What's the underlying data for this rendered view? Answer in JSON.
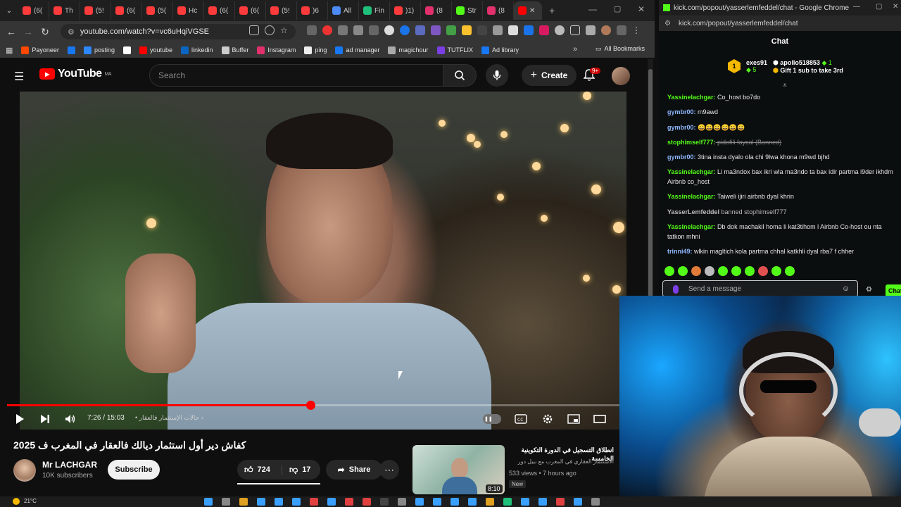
{
  "browser_left": {
    "tabs": [
      {
        "label": "(6(",
        "color": "#ff3b3b"
      },
      {
        "label": "Th",
        "color": "#ff3b3b"
      },
      {
        "label": "(5!",
        "color": "#ff3b3b"
      },
      {
        "label": "(6(",
        "color": "#ff3b3b"
      },
      {
        "label": "(5(",
        "color": "#ff3b3b"
      },
      {
        "label": "Hc",
        "color": "#ff3b3b"
      },
      {
        "label": "(6(",
        "color": "#ff3b3b"
      },
      {
        "label": "(6(",
        "color": "#ff3b3b"
      },
      {
        "label": "(5!",
        "color": "#ff3b3b"
      },
      {
        "label": ")6",
        "color": "#ff3b3b"
      },
      {
        "label": "All",
        "color": "#4c8bf5"
      },
      {
        "label": "Fin",
        "color": "#1ec07a"
      },
      {
        "label": ")1)",
        "color": "#ff3b3b"
      },
      {
        "label": "(8",
        "color": "#e1306c"
      },
      {
        "label": "Str",
        "color": "#53fc18"
      },
      {
        "label": "(8",
        "color": "#e1306c"
      }
    ],
    "new_tab": "+",
    "url": "youtube.com/watch?v=vc6uHqiVGSE",
    "bookmarks": [
      {
        "label": "Payoneer",
        "color": "#ff4800"
      },
      {
        "label": "",
        "color": "#1877f2"
      },
      {
        "label": "posting",
        "color": "#2d88ff"
      },
      {
        "label": "",
        "color": "#ffffff"
      },
      {
        "label": "youtube",
        "color": "#ff0000"
      },
      {
        "label": "linkedin",
        "color": "#0a66c2"
      },
      {
        "label": "Buffer",
        "color": "#cccccc"
      },
      {
        "label": "Instagram",
        "color": "#e1306c"
      },
      {
        "label": "ping",
        "color": "#eeeeee"
      },
      {
        "label": "ad manager",
        "color": "#1877f2"
      },
      {
        "label": "magichour",
        "color": "#aaaaaa"
      },
      {
        "label": "TUTFLIX",
        "color": "#7b3fe4"
      },
      {
        "label": "Ad library",
        "color": "#1877f2"
      }
    ],
    "bookmarks_more": "»",
    "all_bookmarks": "All Bookmarks"
  },
  "youtube": {
    "logo": "YouTube",
    "logo_region": "MA",
    "search_placeholder": "Search",
    "create_label": "Create",
    "notif_count": "9+",
    "player": {
      "current_time": "7:26",
      "duration": "15:03",
      "time_sep": " / ",
      "chapter": "حالات الإستثمار فالعقار",
      "progress": 0.495
    },
    "video_title": "كفاش دير أول استثمار ديالك فالعقار في المغرب ف 2025",
    "channel": {
      "name": "Mr LACHGAR",
      "subs": "10K subscribers"
    },
    "subscribe_label": "Subscribe",
    "likes": "724",
    "dislikes": "17",
    "share_label": "Share",
    "recommended": {
      "title": "انطلاق التسجيل في الدورة التكوينية الخامسة",
      "channel": "الاستثمار العقاري في المغرب مع نبيل دور",
      "meta": "533 views • 7 hours ago",
      "badge": "New",
      "duration": "8:10"
    }
  },
  "kick": {
    "title": "kick.com/popout/yasserlemfeddel/chat - Google Chrome",
    "url": "kick.com/popout/yasserlemfeddel/chat",
    "chat_header": "Chat",
    "leader": {
      "user1": "exes91",
      "user1_count": "5",
      "user2": "apollo518853",
      "user2_count": "1",
      "pinned": "Gift 1 sub to take 3rd"
    },
    "messages": [
      {
        "user": "Yassinelachgar:",
        "text": " Co_host bo7do",
        "color": "#53fc18"
      },
      {
        "user": "gymbr00:",
        "text": " m9awd",
        "color": "#8fb8ff"
      },
      {
        "user": "gymbr00:",
        "text": " 😀😀😀😀😀😀",
        "color": "#8fb8ff"
      },
      {
        "user": "stophimself777:",
        "text": " pidofili faycal (Banned)",
        "color": "#53fc18"
      },
      {
        "user": "gymbr00:",
        "text": " 3tina insta dyalo ola chi 9lwa khona m9wd bjhd",
        "color": "#8fb8ff"
      },
      {
        "user": "Yassinelachgar:",
        "text": " Li ma3ndox bax ikri wla ma3ndo ta bax idir partma i9der ikhdm Airbnb co_host",
        "color": "#53fc18"
      },
      {
        "user": "Yassinelachgar:",
        "text": " Taiweli ijiri airbnb dyal khrin",
        "color": "#53fc18"
      },
      {
        "user": "YasserLemfeddel",
        "text": " banned stophimself777",
        "color": "#bbbbbb"
      },
      {
        "user": "Yassinelachgar:",
        "text": " Db dok machakil homa li kat3tihom l Airbnb Co-host ou nta tatkon mhni",
        "color": "#53fc18"
      },
      {
        "user": "trinni49:",
        "text": " wlkin magltich kola partma chhal katkhli dyal rba7 f chher",
        "color": "#8fb8ff"
      }
    ],
    "input_placeholder": "Send a message",
    "send_label": "Chat"
  },
  "taskbar": {
    "weather": "21°C"
  }
}
